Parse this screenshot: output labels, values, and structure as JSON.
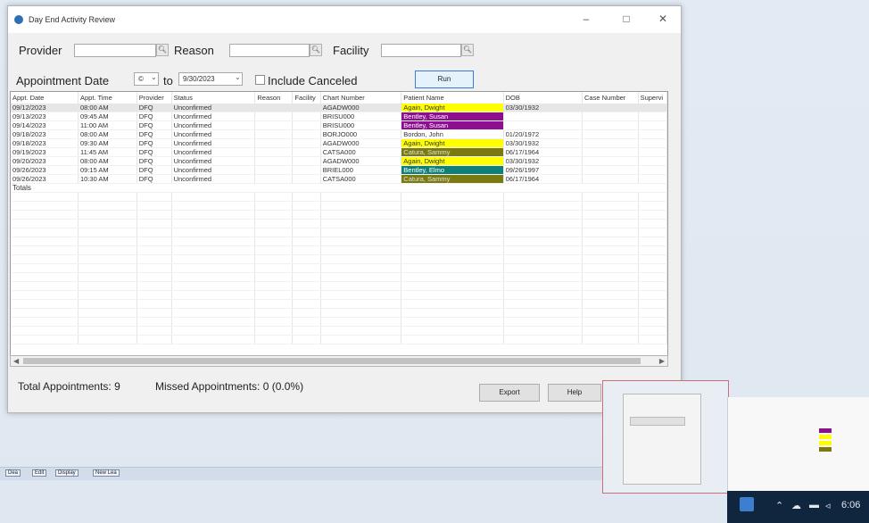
{
  "window": {
    "title": "Day End Activity Review"
  },
  "filters": {
    "provider_label": "Provider",
    "reason_label": "Reason",
    "facility_label": "Facility",
    "appointment_date_label": "Appointment Date",
    "date_from_value": "©",
    "to_label": "to",
    "date_to_value": "9/30/2023",
    "include_canceled_label": "Include Canceled",
    "run_label": "Run"
  },
  "grid": {
    "columns": [
      "Appt. Date",
      "Appt. Time",
      "Provider",
      "Status",
      "Reason",
      "Facility",
      "Chart Number",
      "Patient Name",
      "DOB",
      "Case Number",
      "Supervi"
    ],
    "rows": [
      {
        "date": "09/12/2023",
        "time": "08:00 AM",
        "provider": "DFQ",
        "status": "Unconfirmed",
        "reason": "",
        "facility": "",
        "chart": "AGADW000",
        "patient": "Again, Dwight",
        "dob": "03/30/1932",
        "case": "",
        "sup": ""
      },
      {
        "date": "09/13/2023",
        "time": "09:45 AM",
        "provider": "DFQ",
        "status": "Unconfirmed",
        "reason": "",
        "facility": "",
        "chart": "BRISU000",
        "patient": "Bentley, Susan",
        "dob": "",
        "case": "",
        "sup": ""
      },
      {
        "date": "09/14/2023",
        "time": "11:00 AM",
        "provider": "DFQ",
        "status": "Unconfirmed",
        "reason": "",
        "facility": "",
        "chart": "BRISU000",
        "patient": "Bentley, Susan",
        "dob": "",
        "case": "",
        "sup": ""
      },
      {
        "date": "09/18/2023",
        "time": "08:00 AM",
        "provider": "DFQ",
        "status": "Unconfirmed",
        "reason": "",
        "facility": "",
        "chart": "BORJO000",
        "patient": "Bordon, John",
        "dob": "01/20/1972",
        "case": "",
        "sup": ""
      },
      {
        "date": "09/18/2023",
        "time": "09:30 AM",
        "provider": "DFQ",
        "status": "Unconfirmed",
        "reason": "",
        "facility": "",
        "chart": "AGADW000",
        "patient": "Again, Dwight",
        "dob": "03/30/1932",
        "case": "",
        "sup": ""
      },
      {
        "date": "09/19/2023",
        "time": "11:45 AM",
        "provider": "DFQ",
        "status": "Unconfirmed",
        "reason": "",
        "facility": "",
        "chart": "CATSA000",
        "patient": "Catura, Sammy",
        "dob": "06/17/1964",
        "case": "",
        "sup": ""
      },
      {
        "date": "09/20/2023",
        "time": "08:00 AM",
        "provider": "DFQ",
        "status": "Unconfirmed",
        "reason": "",
        "facility": "",
        "chart": "AGADW000",
        "patient": "Again, Dwight",
        "dob": "03/30/1932",
        "case": "",
        "sup": ""
      },
      {
        "date": "09/26/2023",
        "time": "09:15 AM",
        "provider": "DFQ",
        "status": "Unconfirmed",
        "reason": "",
        "facility": "",
        "chart": "BRIEL000",
        "patient": "Bentley, Elmo",
        "dob": "09/26/1997",
        "case": "",
        "sup": ""
      },
      {
        "date": "09/26/2023",
        "time": "10:30 AM",
        "provider": "DFQ",
        "status": "Unconfirmed",
        "reason": "",
        "facility": "",
        "chart": "CATSA000",
        "patient": "Catura, Sammy",
        "dob": "06/17/1964",
        "case": "",
        "sup": ""
      }
    ],
    "totals_label": "Totals"
  },
  "patient_colors": {
    "Again, Dwight": {
      "bg": "#ffff00",
      "fg": "#333333"
    },
    "Bentley, Susan": {
      "bg": "#8b0f8f",
      "fg": "#ffffff"
    },
    "Bordon, John": {
      "bg": "",
      "fg": "#333333"
    },
    "Catura, Sammy": {
      "bg": "#7a7a10",
      "fg": "#e0e0e0"
    },
    "Bentley, Elmo": {
      "bg": "#0f7f7a",
      "fg": "#ffffff"
    }
  },
  "footer": {
    "total_appointments": "Total Appointments: 9",
    "missed_appointments": "Missed Appointments: 0 (0.0%)",
    "export_label": "Export",
    "help_label": "Help"
  },
  "taskstrip": {
    "b1": "Dea",
    "b2": "Edit",
    "b3": "Display",
    "b4": "New Lea"
  },
  "tray": {
    "time": "6:06"
  },
  "icons": [
    "app-icon",
    "search-icon",
    "dropdown-icon",
    "minimize-icon",
    "maximize-icon",
    "close-icon"
  ]
}
